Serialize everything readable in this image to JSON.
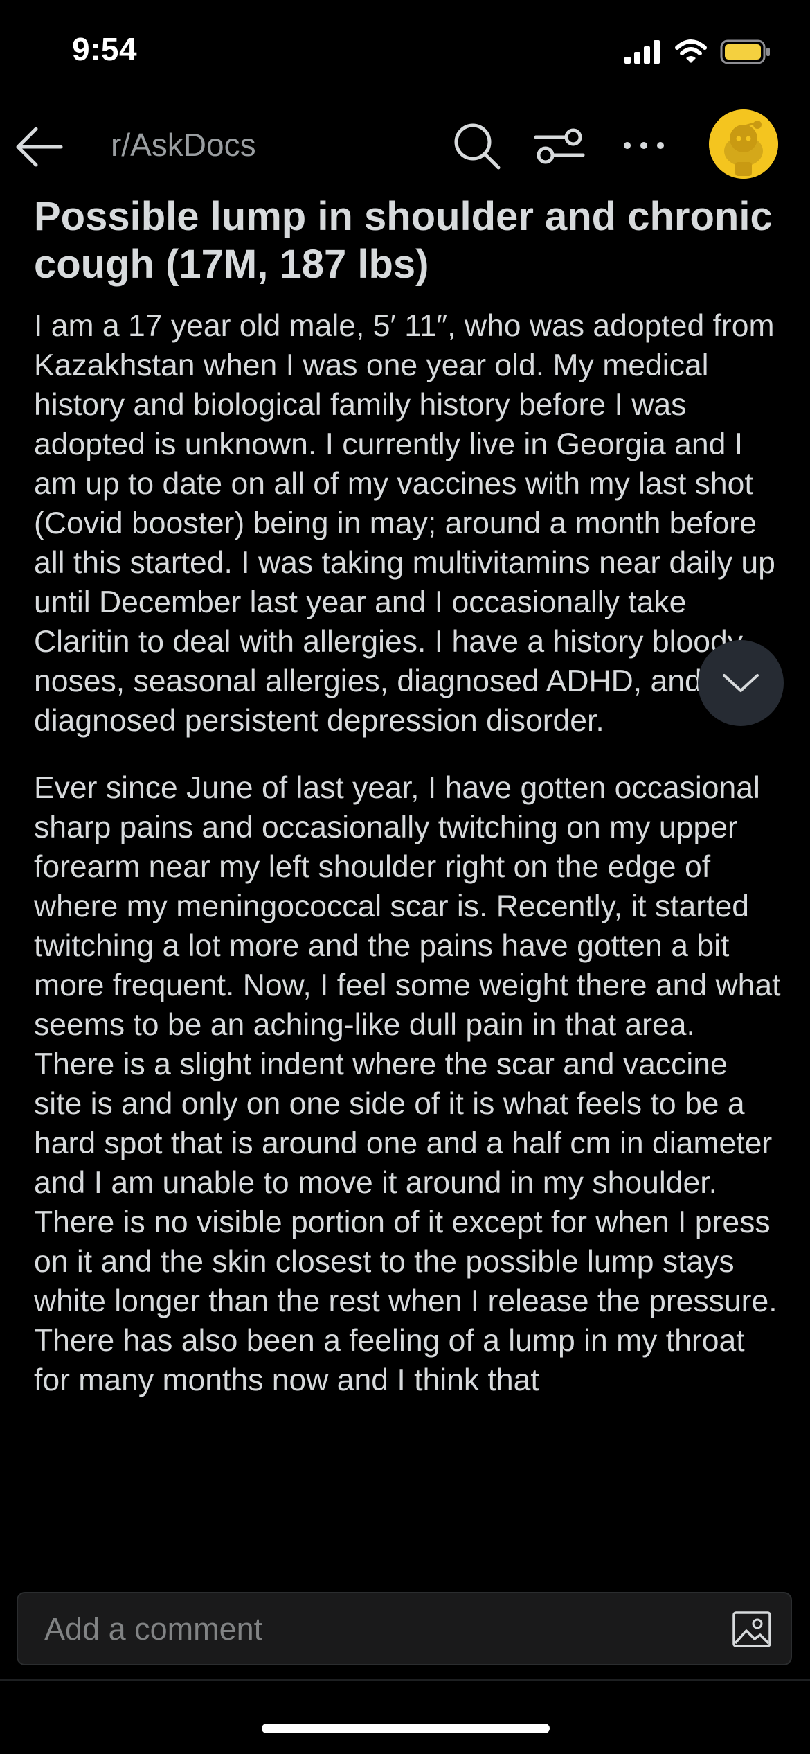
{
  "status_bar": {
    "time": "9:54",
    "icons": [
      "cellular-signal-icon",
      "wifi-icon",
      "battery-icon"
    ],
    "battery_color": "#f4d03f"
  },
  "header": {
    "subreddit": "r/AskDocs",
    "icons": [
      "back-arrow-icon",
      "search-icon",
      "filter-icon",
      "more-options-icon",
      "snoo-avatar-icon"
    ],
    "avatar_color": "#f4c51f"
  },
  "post": {
    "title": "Possible lump in shoulder and chronic cough (17M, 187 lbs)",
    "paragraph_1": "I am a 17 year old male, 5′ 11″, who was adopted from Kazakhstan when I was one year old. My medical history and biological family history before I was adopted is unknown. I currently live in Georgia and I am up to date on all of my vaccines with my last shot (Covid booster) being in may; around a month before all this started. I was taking multivitamins near daily up until December last year and I occasionally take Claritin to deal with allergies. I have a history bloody noses, seasonal allergies, diagnosed ADHD, and diagnosed persistent depression disorder.",
    "paragraph_2": "Ever since June of last year, I have gotten occasional sharp pains and occasionally twitching on my upper forearm near my left shoulder right on the edge of where my meningococcal scar is. Recently, it started twitching a lot more and the pains have gotten a bit more frequent. Now, I feel some weight there and what seems to be an aching-like dull pain in that area. There is a slight indent where the scar and vaccine site is and only on one side of it is what feels to be a hard spot that is around one and a half cm in diameter and I am unable to move it around in my shoulder. There is no visible portion of it except for when I press on it and the skin closest to the possible lump stays white longer than the rest when I release the pressure. There has also been a feeling of a lump in my throat for many months now and I think that"
  },
  "scroll_button": {
    "icon": "chevron-down-icon"
  },
  "comment_bar": {
    "placeholder": "Add a comment",
    "icon": "add-image-icon"
  },
  "colors": {
    "background": "#000000",
    "text": "#d7dadc",
    "muted": "#9a9ea1"
  }
}
